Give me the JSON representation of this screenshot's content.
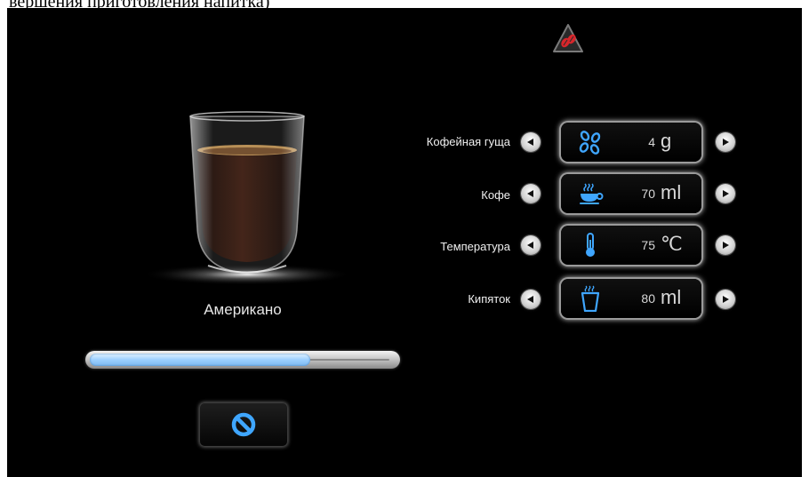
{
  "top_caption": "вершения приготовления напитка)",
  "drink": {
    "name": "Американо"
  },
  "progress": {
    "fraction": 0.72
  },
  "icons": {
    "warning": "coffee-beans-warning-icon",
    "cancel": "prohibit-icon",
    "arrow_left": "arrow-left-icon",
    "arrow_right": "arrow-right-icon"
  },
  "colors": {
    "accent": "#3fa6ff",
    "warning": "#d8262b",
    "background": "#000000"
  },
  "params": [
    {
      "label": "Кофейная гуща",
      "value": "4",
      "unit": "g",
      "icon": "coffee-beans-icon"
    },
    {
      "label": "Кофе",
      "value": "70",
      "unit": "ml",
      "icon": "coffee-cup-icon"
    },
    {
      "label": "Температура",
      "value": "75",
      "unit": "℃",
      "icon": "thermometer-icon"
    },
    {
      "label": "Кипяток",
      "value": "80",
      "unit": "ml",
      "icon": "hot-water-cup-icon"
    }
  ]
}
